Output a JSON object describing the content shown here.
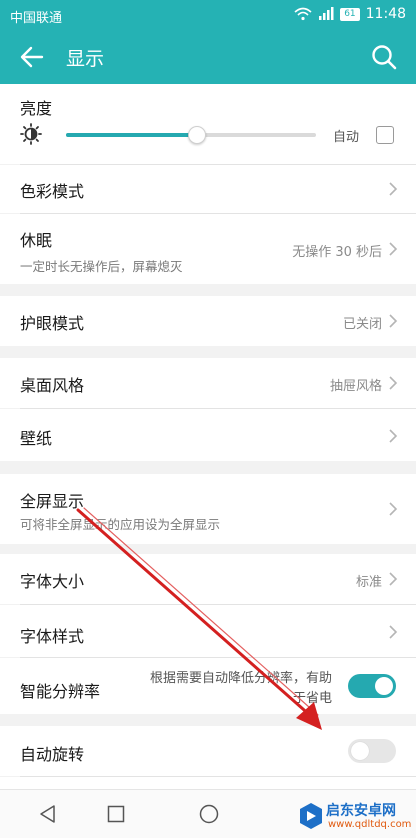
{
  "status_bar": {
    "carrier": "中国联通",
    "battery": "61",
    "time": "11:48"
  },
  "header": {
    "title": "显示"
  },
  "brightness": {
    "label": "亮度",
    "auto_label": "自动",
    "level": 0.52,
    "auto_checked": false
  },
  "items": {
    "color_mode": {
      "label": "色彩模式"
    },
    "sleep": {
      "label": "休眠",
      "sub": "一定时长无操作后，屏幕熄灭",
      "value": "无操作 30 秒后"
    },
    "eye_comfort": {
      "label": "护眼模式",
      "value": "已关闭"
    },
    "desktop_style": {
      "label": "桌面风格",
      "value": "抽屉风格"
    },
    "wallpaper": {
      "label": "壁纸"
    },
    "fullscreen": {
      "label": "全屏显示",
      "sub": "可将非全屏显示的应用设为全屏显示"
    },
    "font_size": {
      "label": "字体大小",
      "value": "标准"
    },
    "font_style": {
      "label": "字体样式"
    },
    "smart_resolution": {
      "label": "智能分辨率",
      "desc_line1": "根据需要自动降低分辨率，有助",
      "desc_line2": "于省电",
      "enabled": true
    },
    "auto_rotate": {
      "label": "自动旋转",
      "enabled": false
    }
  },
  "watermark": {
    "title": "启东安卓网",
    "url": "www.qdltdq.com"
  },
  "colors": {
    "accent": "#25b2b4",
    "toggle_on": "#25a9b0",
    "annotation_arrow": "#d42020"
  }
}
